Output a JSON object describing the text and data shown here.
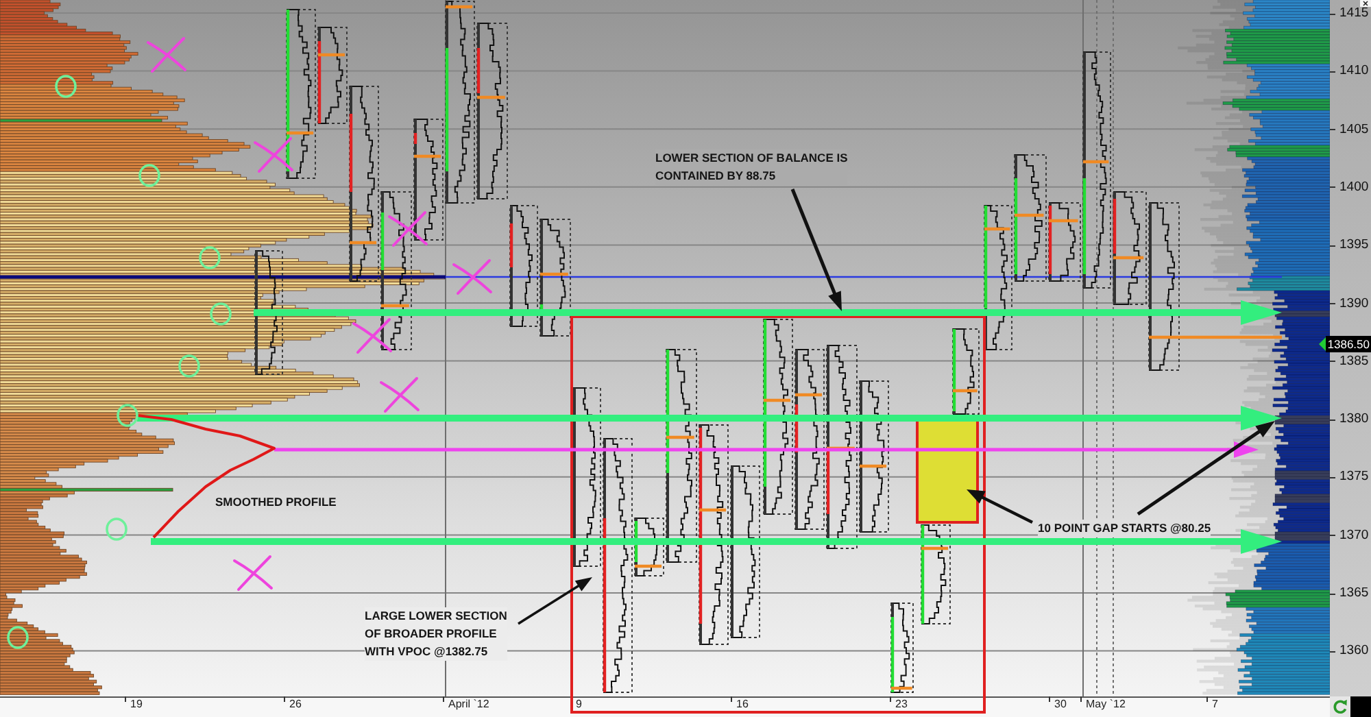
{
  "chart": {
    "annotations": [
      {
        "text": "LOWER SECTION OF BALANCE IS\nCONTAINED BY 88.75"
      },
      {
        "text": "SMOOTHED PROFILE"
      },
      {
        "text": "10 POINT GAP STARTS @80.25"
      },
      {
        "text": "LARGE LOWER SECTION\nOF BROADER PROFILE\nWITH VPOC @1382.75"
      }
    ],
    "date_axis": {
      "labels": [
        "19",
        "26",
        "April `12",
        "9",
        "16",
        "23",
        "30",
        "May `12",
        "7"
      ]
    }
  },
  "price_axis": {
    "labels": [
      "1415",
      "1410",
      "1405",
      "1400",
      "1395",
      "1390",
      "1385",
      "1380",
      "1375",
      "1370",
      "1365",
      "1360"
    ],
    "current_price": "1386.50"
  }
}
